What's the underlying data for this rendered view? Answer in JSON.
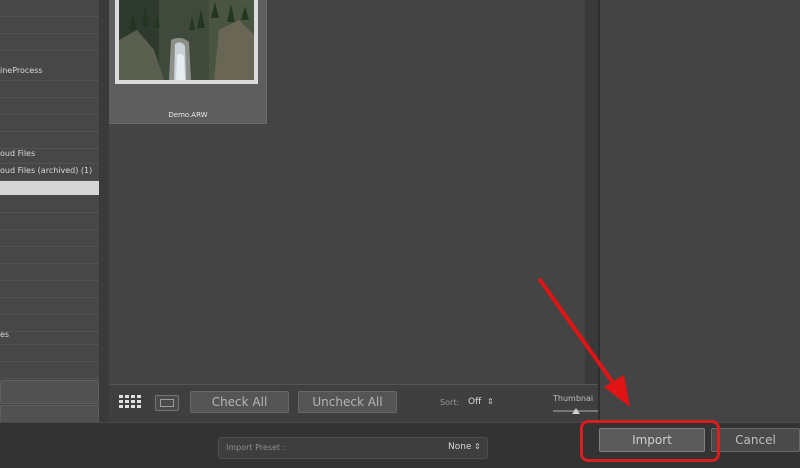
{
  "left_panel": {
    "items": [
      {
        "label": ""
      },
      {
        "label": ""
      },
      {
        "label": ""
      },
      {
        "label": "ineProcess"
      },
      {
        "label": ""
      },
      {
        "label": ""
      },
      {
        "label": ""
      },
      {
        "label": ""
      },
      {
        "label": "oud Files"
      },
      {
        "label": "oud Files (archived) (1)"
      },
      {
        "label": ""
      },
      {
        "label": ""
      },
      {
        "label": ""
      },
      {
        "label": ""
      },
      {
        "label": ""
      },
      {
        "label": ""
      },
      {
        "label": ""
      },
      {
        "label": ""
      },
      {
        "label": ""
      },
      {
        "label": "es"
      },
      {
        "label": ""
      }
    ]
  },
  "grid": {
    "thumbnail": {
      "filename": "Demo.ARW"
    }
  },
  "toolbar": {
    "check_all": "Check All",
    "uncheck_all": "Uncheck All",
    "sort_label": "Sort:",
    "sort_value": "Off",
    "thumbnail_label": "Thumbnai",
    "thumbnail_size": 0.5,
    "chevron_icon": "up-down-chevron-icon"
  },
  "footer": {
    "preset_label": "Import Preset :",
    "preset_value": "None",
    "import": "Import",
    "cancel": "Cancel"
  },
  "annotation": {
    "color": "#d81e1e"
  }
}
